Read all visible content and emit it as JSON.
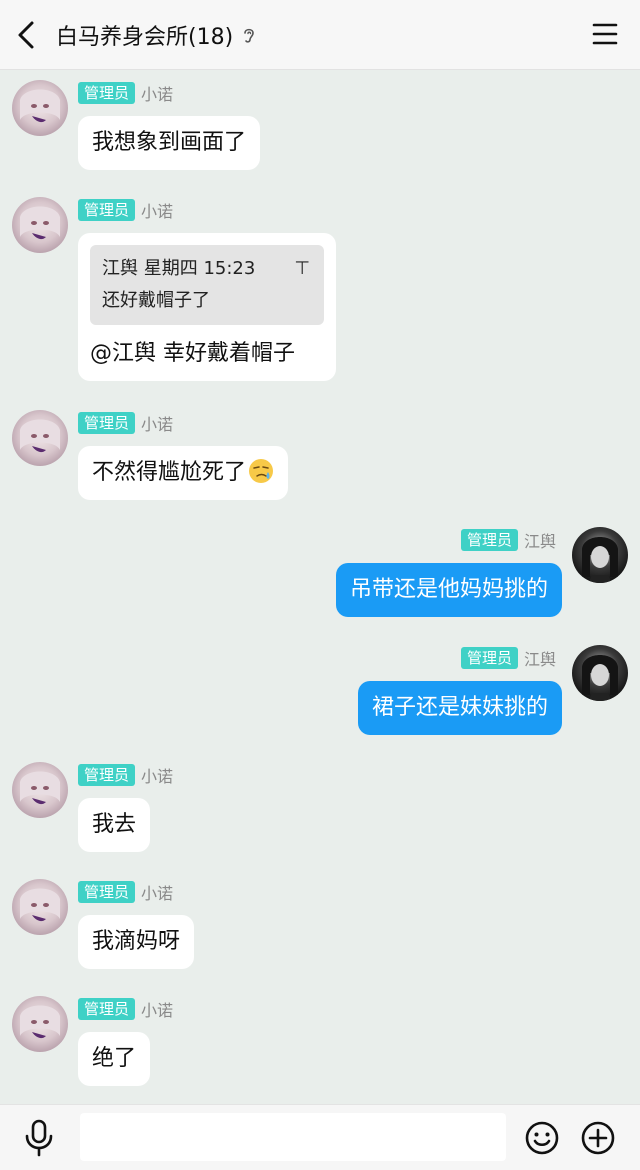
{
  "header": {
    "title": "白马养身会所(18)"
  },
  "messages": [
    {
      "side": "left",
      "avatar": "avatar-xiaonuo",
      "role": "管理员",
      "sender": "小诺",
      "text": "我想象到画面了"
    },
    {
      "side": "left",
      "avatar": "avatar-xiaonuo",
      "role": "管理员",
      "sender": "小诺",
      "quote": {
        "author": "江舆 星期四 15:23",
        "text": "还好戴帽子了",
        "close_glyph": "⊤"
      },
      "text": "@江舆 幸好戴着帽子"
    },
    {
      "side": "left",
      "avatar": "avatar-xiaonuo",
      "role": "管理员",
      "sender": "小诺",
      "text": "不然得尴尬死了",
      "emoji": "sweat-face-emoji"
    },
    {
      "side": "right",
      "avatar": "avatar-jiangyu",
      "role": "管理员",
      "sender": "江舆",
      "text": "吊带还是他妈妈挑的"
    },
    {
      "side": "right",
      "avatar": "avatar-jiangyu",
      "role": "管理员",
      "sender": "江舆",
      "text": "裙子还是妹妹挑的"
    },
    {
      "side": "left",
      "avatar": "avatar-xiaonuo",
      "role": "管理员",
      "sender": "小诺",
      "text": "我去"
    },
    {
      "side": "left",
      "avatar": "avatar-xiaonuo",
      "role": "管理员",
      "sender": "小诺",
      "text": "我滴妈呀"
    },
    {
      "side": "left",
      "avatar": "avatar-xiaonuo",
      "role": "管理员",
      "sender": "小诺",
      "text": "绝了"
    }
  ],
  "input": {
    "value": "",
    "placeholder": ""
  },
  "colors": {
    "badge": "#3fd1c6",
    "outgoing_bubble": "#1a9bf5",
    "background": "#e9eeeb"
  }
}
